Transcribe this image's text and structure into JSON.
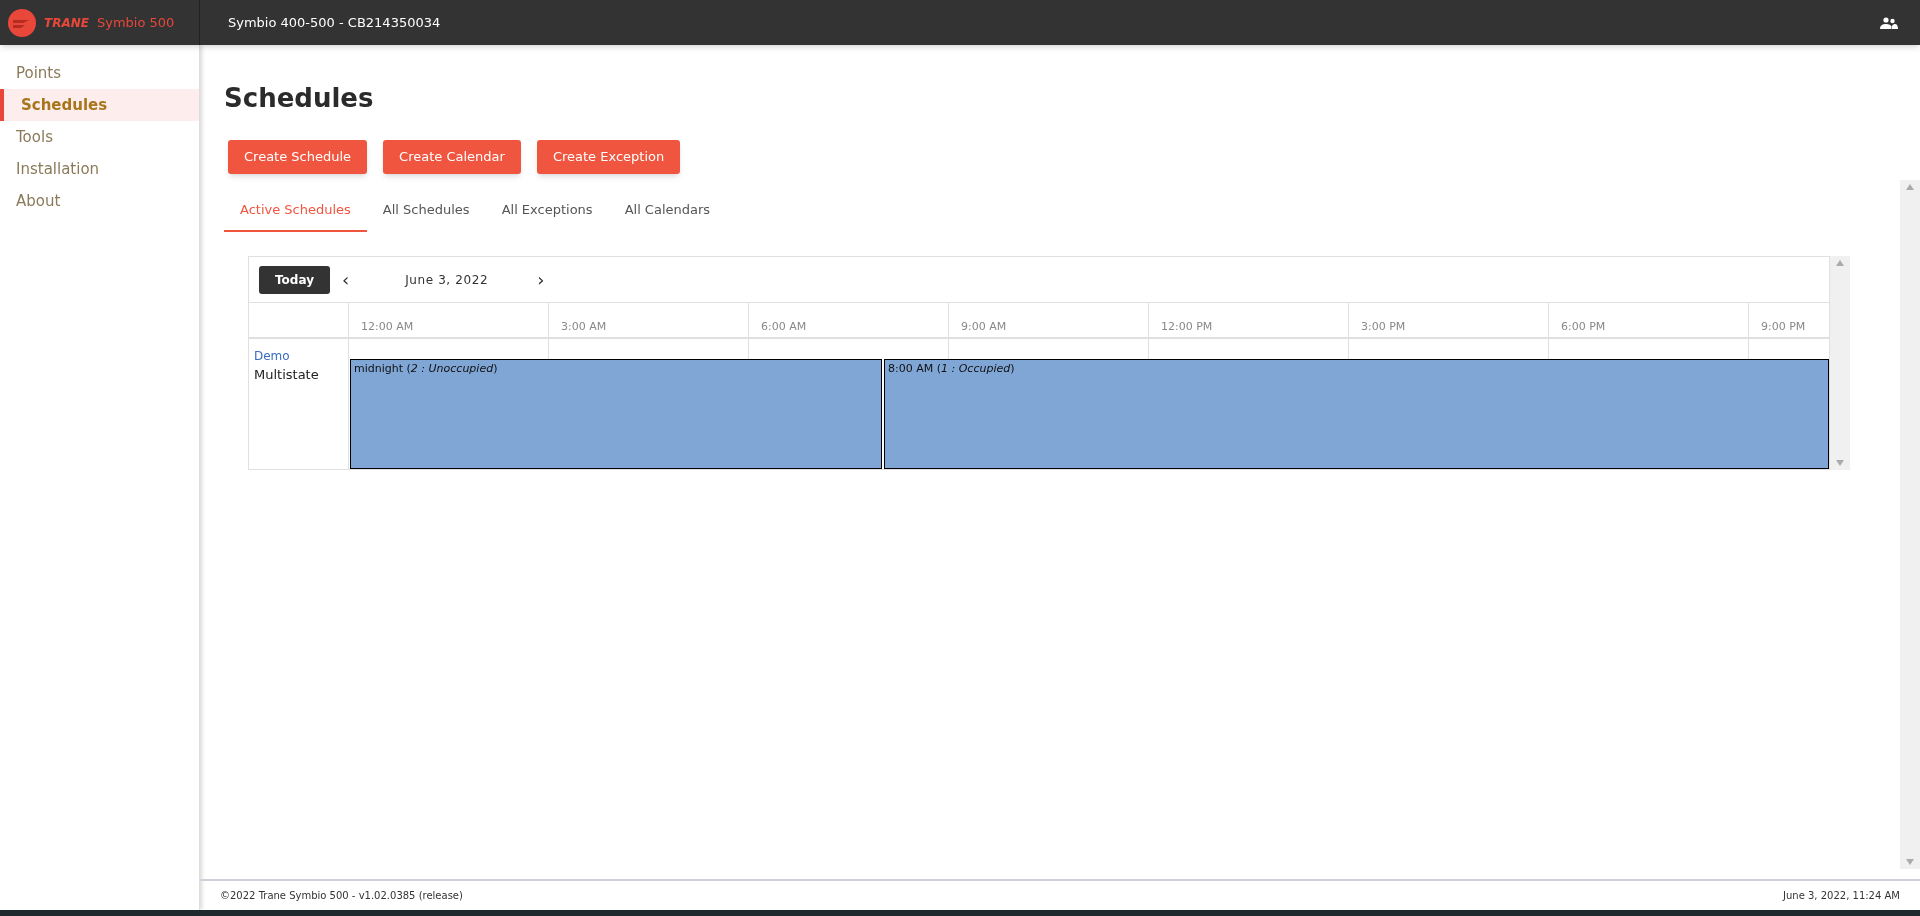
{
  "header": {
    "brand": "TRANE",
    "product": "Symbio 500",
    "device_title": "Symbio 400-500 - CB214350034"
  },
  "sidebar": {
    "items": [
      {
        "label": "Points",
        "selected": false
      },
      {
        "label": "Schedules",
        "selected": true
      },
      {
        "label": "Tools",
        "selected": false
      },
      {
        "label": "Installation",
        "selected": false
      },
      {
        "label": "About",
        "selected": false
      }
    ]
  },
  "page": {
    "title": "Schedules",
    "buttons": [
      "Create Schedule",
      "Create Calendar",
      "Create Exception"
    ],
    "tabs": [
      {
        "label": "Active Schedules",
        "selected": true
      },
      {
        "label": "All Schedules",
        "selected": false
      },
      {
        "label": "All Exceptions",
        "selected": false
      },
      {
        "label": "All Calendars",
        "selected": false
      }
    ]
  },
  "calendar": {
    "today_button": "Today",
    "prev": "‹",
    "next": "›",
    "date": "June 3, 2022",
    "hours": [
      "12:00 AM",
      "3:00 AM",
      "6:00 AM",
      "9:00 AM",
      "12:00 PM",
      "3:00 PM",
      "6:00 PM",
      "9:00 PM"
    ],
    "rows": [
      {
        "name": "Demo",
        "type": "Multistate",
        "events": [
          {
            "text": "midnight (*2 : Unoccupied*)"
          },
          {
            "text": "8:00 AM (*1 : Occupied*)"
          }
        ]
      }
    ]
  },
  "footer": {
    "copyright": "©2022 Trane Symbio 500 - v1.02.0385 (release)",
    "datetime": "June 3, 2022, 11:24 AM"
  }
}
